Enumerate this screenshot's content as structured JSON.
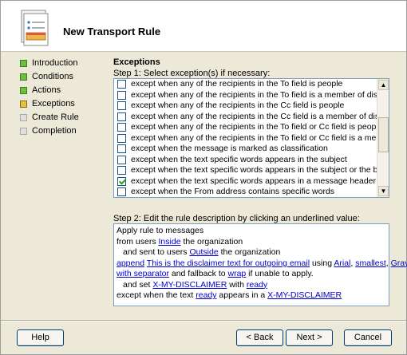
{
  "window": {
    "title": "New Transport Rule"
  },
  "nav": {
    "items": [
      {
        "label": "Introduction",
        "status": "done"
      },
      {
        "label": "Conditions",
        "status": "done"
      },
      {
        "label": "Actions",
        "status": "done"
      },
      {
        "label": "Exceptions",
        "status": "current"
      },
      {
        "label": "Create Rule",
        "status": "pending"
      },
      {
        "label": "Completion",
        "status": "pending"
      }
    ]
  },
  "exceptions": {
    "title": "Exceptions",
    "step1_label": "Step 1: Select exception(s) if necessary:",
    "items": [
      {
        "label": "except when any of the recipients in the To field is people",
        "checked": false
      },
      {
        "label": "except when any of the recipients in the To field is a member of distribution list",
        "checked": false
      },
      {
        "label": "except when any of the recipients in the Cc field is people",
        "checked": false
      },
      {
        "label": "except when any of the recipients in the Cc field is a member of distribution list",
        "checked": false
      },
      {
        "label": "except when any of the recipients in the To field or Cc field is people",
        "checked": false
      },
      {
        "label": "except when any of the recipients in the To field or Cc field is a member of distributi",
        "checked": false
      },
      {
        "label": "except when the message is marked as classification",
        "checked": false
      },
      {
        "label": "except when the text specific words appears in the subject",
        "checked": false
      },
      {
        "label": "except when the text specific words appears in the subject or the body of the mess",
        "checked": false
      },
      {
        "label": "except when the text specific words appears in a message header",
        "checked": true
      },
      {
        "label": "except when the From address contains specific words",
        "checked": false
      }
    ],
    "step2_label": "Step 2: Edit the rule description by clicking an underlined value:"
  },
  "description": {
    "line1": "Apply rule to messages",
    "line2_a": "from users ",
    "line2_link": "Inside",
    "line2_b": " the organization",
    "line3_a": "and sent to users ",
    "line3_link": "Outside",
    "line3_b": " the organization",
    "line4_link1": "append",
    "line4_sp1": " ",
    "line4_link2": "This is the disclaimer text for outgoing email",
    "line4_t1": " using ",
    "line4_link3": "Arial",
    "line4_t2": ", ",
    "line4_link4": "smallest",
    "line4_t3": ", ",
    "line4_link5": "Gray",
    "line4_t4": ",",
    "line5_link1": "with separator",
    "line5_t1": " and fallback to ",
    "line5_link2": "wrap",
    "line5_t2": " if unable to apply.",
    "line6_a": "and set ",
    "line6_link1": "X-MY-DISCLAIMER",
    "line6_b": " with ",
    "line6_link2": "ready",
    "line7_a": "except when the text ",
    "line7_link1": "ready",
    "line7_b": " appears in a ",
    "line7_link2": "X-MY-DISCLAIMER"
  },
  "buttons": {
    "help": "Help",
    "back": "< Back",
    "next": "Next >",
    "cancel": "Cancel"
  },
  "colors": {
    "nav_done": "#6fbf3f",
    "nav_current": "#e6c23a",
    "nav_pending": "#e0e0e0",
    "link": "#0000cc"
  }
}
